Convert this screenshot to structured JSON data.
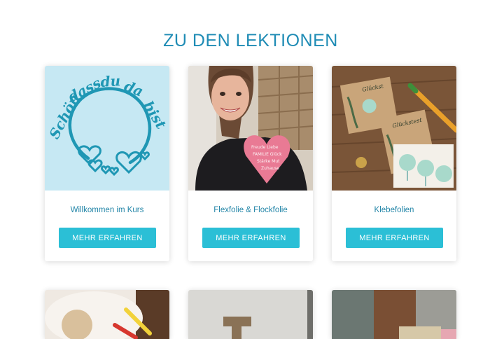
{
  "section": {
    "heading": "ZU DEN LEKTIONEN"
  },
  "courses": [
    {
      "title": "Willkommen im Kurs",
      "button_label": "MEHR ERFAHREN",
      "image": "welcome-wreath-illustration"
    },
    {
      "title": "Flexfolie & Flockfolie",
      "button_label": "MEHR ERFAHREN",
      "image": "woman-heart-shirt-photo"
    },
    {
      "title": "Klebefolien",
      "button_label": "MEHR ERFAHREN",
      "image": "greeting-cards-stickers-photo"
    }
  ],
  "colors": {
    "heading": "#1f8cb5",
    "button": "#2bbfd6",
    "card_title": "#2486a8",
    "thumb_bg": "#c6e8f3"
  }
}
